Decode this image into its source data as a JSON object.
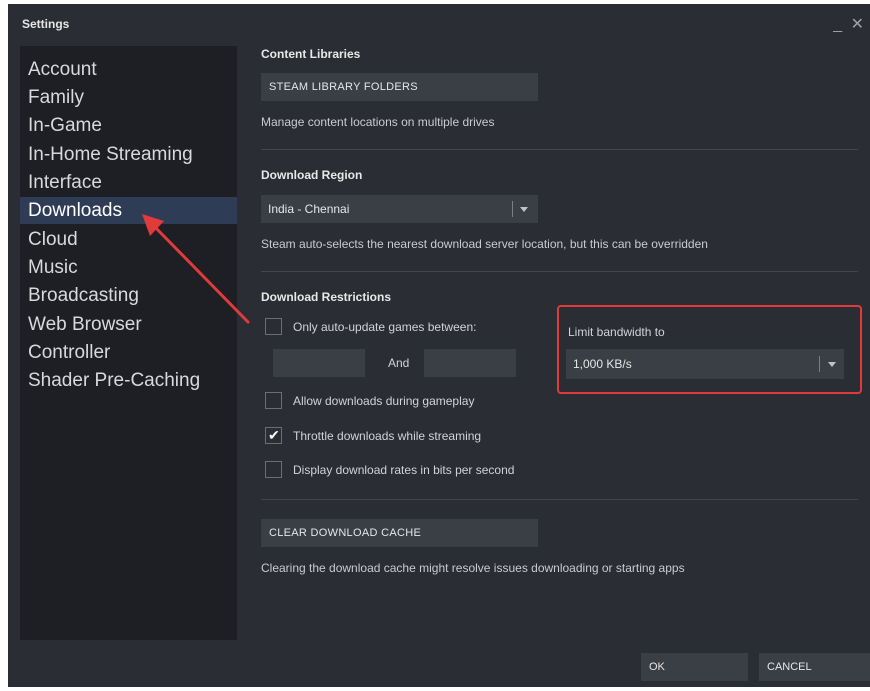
{
  "window": {
    "title": "Settings",
    "controls": "_ ✕"
  },
  "sidebar": {
    "items": [
      {
        "label": "Account"
      },
      {
        "label": "Family"
      },
      {
        "label": "In-Game"
      },
      {
        "label": "In-Home Streaming"
      },
      {
        "label": "Interface"
      },
      {
        "label": "Downloads"
      },
      {
        "label": "Cloud"
      },
      {
        "label": "Music"
      },
      {
        "label": "Broadcasting"
      },
      {
        "label": "Web Browser"
      },
      {
        "label": "Controller"
      },
      {
        "label": "Shader Pre-Caching"
      }
    ],
    "active": "Downloads"
  },
  "content_libraries": {
    "title": "Content Libraries",
    "button_label": "STEAM LIBRARY FOLDERS",
    "description": "Manage content locations on multiple drives"
  },
  "download_region": {
    "title": "Download Region",
    "selected": "India - Chennai",
    "description": "Steam auto-selects the nearest download server location, but this can be overridden"
  },
  "download_restrictions": {
    "title": "Download Restrictions",
    "auto_update_label": "Only auto-update games between:",
    "and_label": "And",
    "bandwidth_label": "Limit bandwidth to",
    "bandwidth_value": "1,000 KB/s",
    "allow_during_gameplay_label": "Allow downloads during gameplay",
    "throttle_label": "Throttle downloads while streaming",
    "bits_label": "Display download rates in bits per second"
  },
  "cache": {
    "button_label": "CLEAR DOWNLOAD CACHE",
    "description": "Clearing the download cache might resolve issues downloading or starting apps"
  },
  "footer": {
    "ok_label": "OK",
    "cancel_label": "CANCEL"
  },
  "colors": {
    "annotation": "#e03a3a",
    "active_nav": "#2e3c55"
  }
}
